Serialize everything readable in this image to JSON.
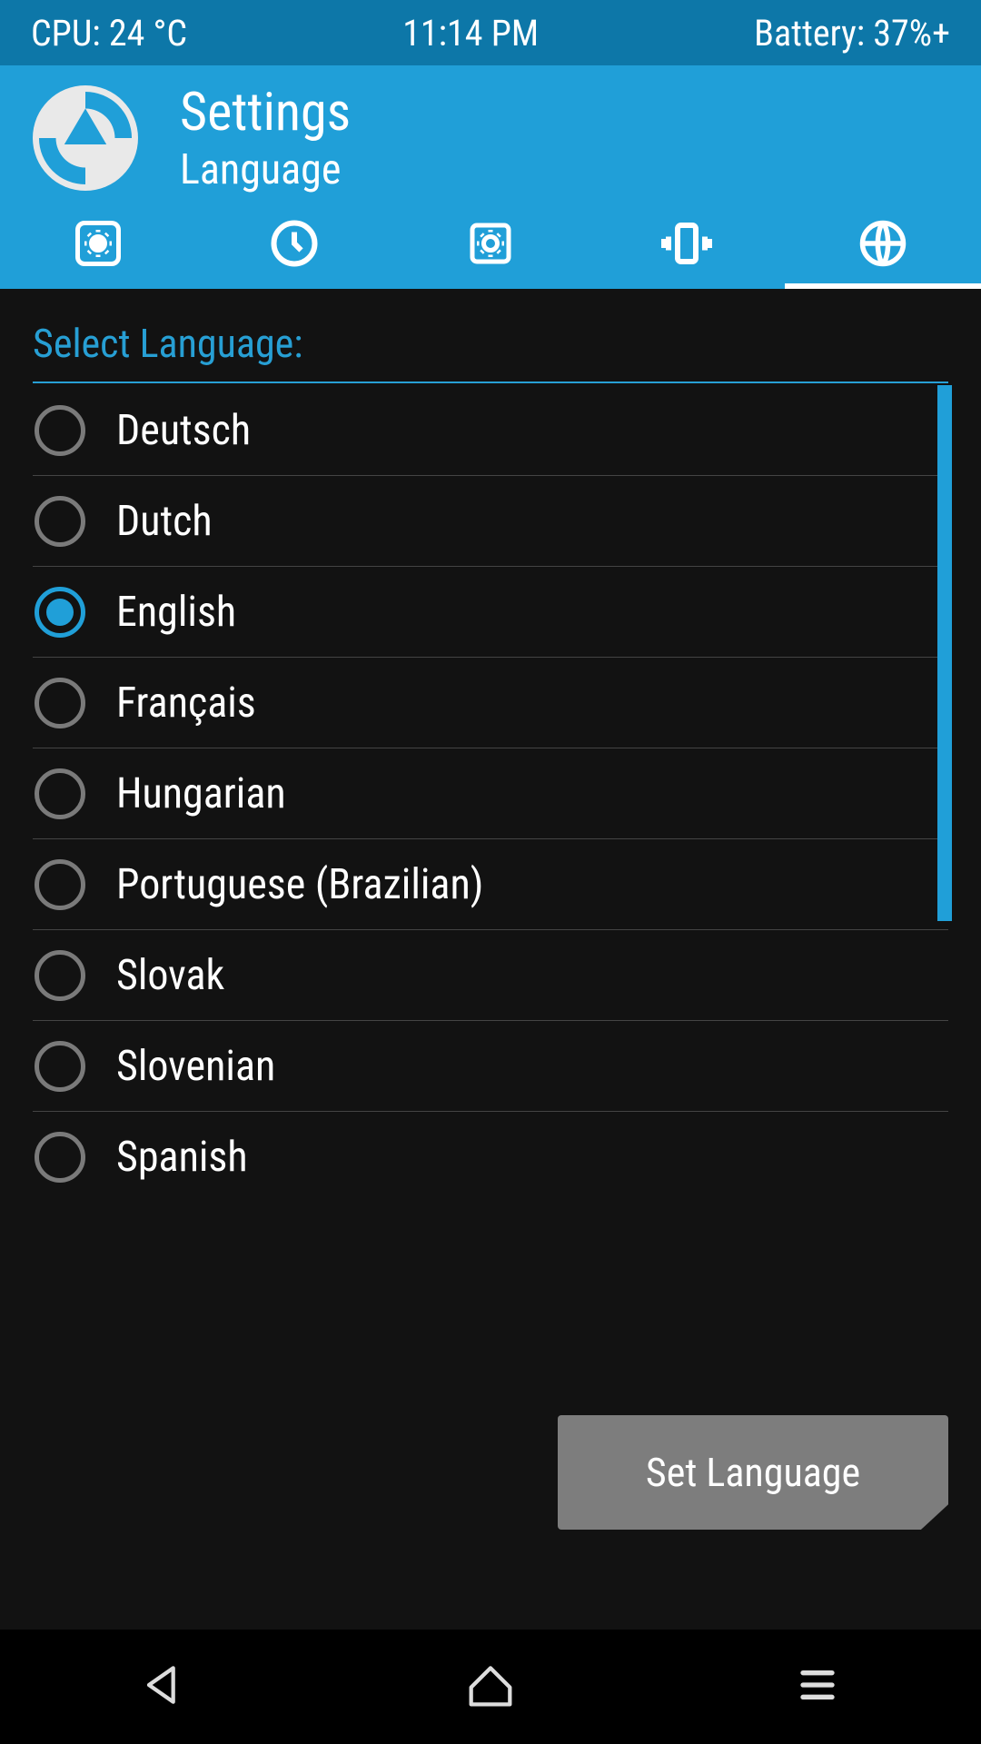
{
  "status_bar": {
    "cpu": "CPU: 24 °C",
    "time": "11:14 PM",
    "battery": "Battery: 37%+"
  },
  "colors": {
    "accent_dark": "#0d77a8",
    "accent": "#209fd8",
    "bg": "#121212",
    "button": "#7d7d7d"
  },
  "header": {
    "title": "Settings",
    "subtitle": "Language"
  },
  "tabs": [
    {
      "icon": "gear-icon",
      "active": false
    },
    {
      "icon": "clock-icon",
      "active": false
    },
    {
      "icon": "brightness-icon",
      "active": false
    },
    {
      "icon": "vibration-icon",
      "active": false
    },
    {
      "icon": "globe-icon",
      "active": true
    }
  ],
  "content": {
    "section_title": "Select Language:",
    "button_label": "Set Language"
  },
  "languages": [
    {
      "name": "Deutsch",
      "selected": false
    },
    {
      "name": "Dutch",
      "selected": false
    },
    {
      "name": "English",
      "selected": true
    },
    {
      "name": "Français",
      "selected": false
    },
    {
      "name": "Hungarian",
      "selected": false
    },
    {
      "name": "Portuguese (Brazilian)",
      "selected": false
    },
    {
      "name": "Slovak",
      "selected": false
    },
    {
      "name": "Slovenian",
      "selected": false
    },
    {
      "name": "Spanish",
      "selected": false
    }
  ],
  "nav": {
    "back": "back-icon",
    "home": "home-icon",
    "menu": "menu-icon"
  }
}
